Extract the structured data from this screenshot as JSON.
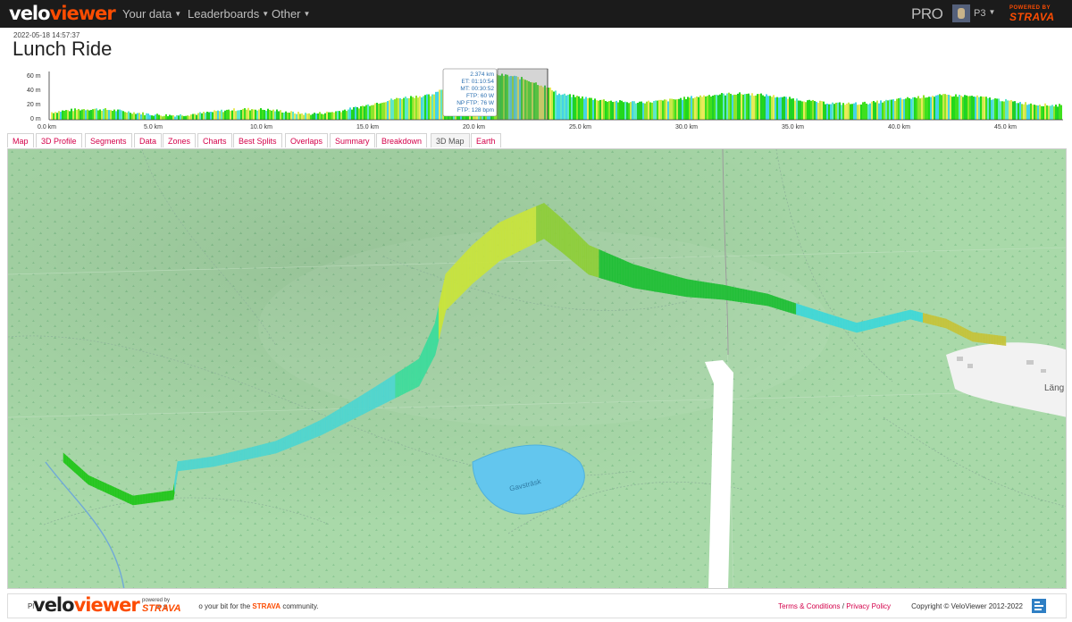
{
  "navbar": {
    "logo": {
      "part1": "velo",
      "part2": "viewer"
    },
    "menu": [
      {
        "label": "Your data"
      },
      {
        "label": "Leaderboards"
      },
      {
        "label": "Other"
      }
    ],
    "pro_label": "PRO",
    "user_label": "P3",
    "powered_by": "POWERED BY",
    "strava": "STRAVA"
  },
  "activity": {
    "timestamp": "2022-05-18 14:57:37",
    "title": "Lunch Ride"
  },
  "profile": {
    "y_ticks": [
      "60 m",
      "40 m",
      "20 m",
      "0 m"
    ],
    "x_ticks": [
      "0.0 km",
      "5.0 km",
      "10.0 km",
      "15.0 km",
      "20.0 km",
      "25.0 km",
      "30.0 km",
      "35.0 km",
      "40.0 km",
      "45.0 km"
    ],
    "tooltip": [
      "2.374 km",
      "ET: 01:10:54",
      "MT: 00:30:52",
      "FTP: 60 W",
      "NP FTP: 76 W",
      "FTP: 128 bpm"
    ]
  },
  "tabs": [
    {
      "label": "Map"
    },
    {
      "label": "3D Profile"
    },
    {
      "label": "Segments"
    },
    {
      "label": "Data"
    },
    {
      "label": "Zones"
    },
    {
      "label": "Charts"
    },
    {
      "label": "Best Splits"
    },
    {
      "label": "Overlaps"
    },
    {
      "label": "Summary"
    },
    {
      "label": "Breakdown"
    },
    {
      "label": "3D Map"
    },
    {
      "label": "Earth"
    }
  ],
  "map": {
    "lake_label": "Gavsträsk",
    "place_label": "Läng"
  },
  "footer": {
    "text_start": "Pl",
    "text_mid": "e s",
    "text_end": "o your bit for the",
    "text_strava": "STRAVA",
    "text_tail": "community.",
    "logo": {
      "part1": "velo",
      "part2": "viewer"
    },
    "powered": "powered by",
    "powered_strava": "STRAVA",
    "terms": "Terms & Conditions",
    "separator": "/",
    "privacy": "Privacy Policy",
    "copyright": "Copyright © VeloViewer 2012-2022"
  },
  "colors": {
    "accent": "#d4004a",
    "strava": "#fc4c02",
    "navbar": "#1b1b1b",
    "map_green": "#a9d9a9",
    "lake": "#63c6ee"
  }
}
